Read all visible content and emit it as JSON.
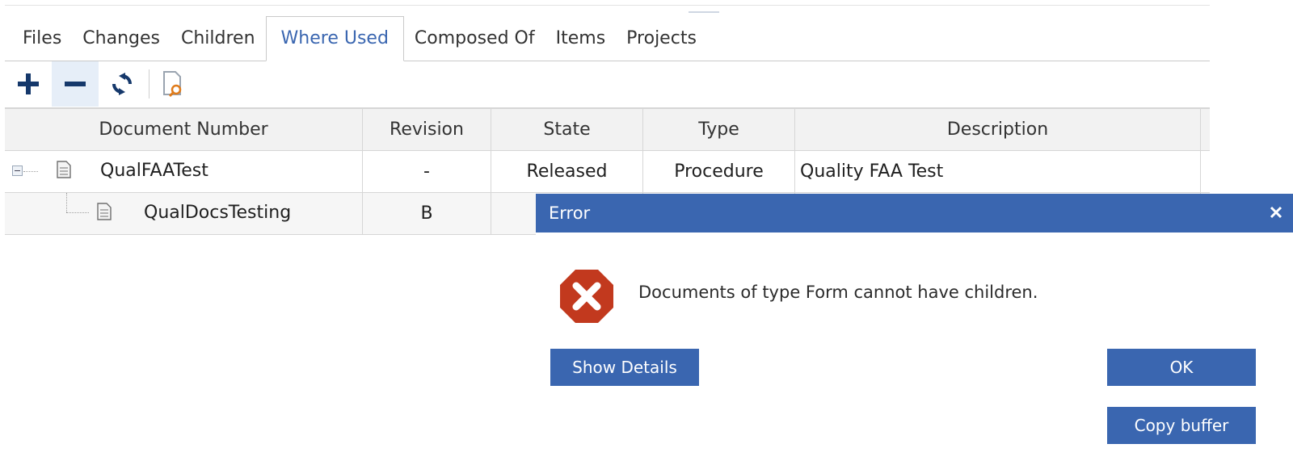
{
  "tabs": [
    {
      "label": "Files"
    },
    {
      "label": "Changes"
    },
    {
      "label": "Children"
    },
    {
      "label": "Where Used"
    },
    {
      "label": "Composed Of"
    },
    {
      "label": "Items"
    },
    {
      "label": "Projects"
    }
  ],
  "active_tab": "Where Used",
  "toolbar": {
    "icons": [
      "plus-icon",
      "minus-icon",
      "refresh-icon",
      "document-search-icon"
    ]
  },
  "grid": {
    "columns": [
      "Document Number",
      "Revision",
      "State",
      "Type",
      "Description"
    ],
    "rows": [
      {
        "document_number": "QualFAATest",
        "revision": "-",
        "state": "Released",
        "type": "Procedure",
        "description": "Quality FAA Test"
      },
      {
        "document_number": "QualDocsTesting",
        "revision": "B",
        "state": "",
        "type": "",
        "description": ""
      }
    ]
  },
  "dialog": {
    "title": "Error",
    "message": "Documents of type Form cannot have children.",
    "buttons": {
      "show_details": "Show Details",
      "ok": "OK",
      "copy_buffer": "Copy buffer"
    },
    "icons": [
      "error-icon",
      "close-icon"
    ]
  },
  "colors": {
    "accent": "#3a66b0",
    "error": "#c0392b",
    "active_tab_text": "#3a66b0"
  }
}
